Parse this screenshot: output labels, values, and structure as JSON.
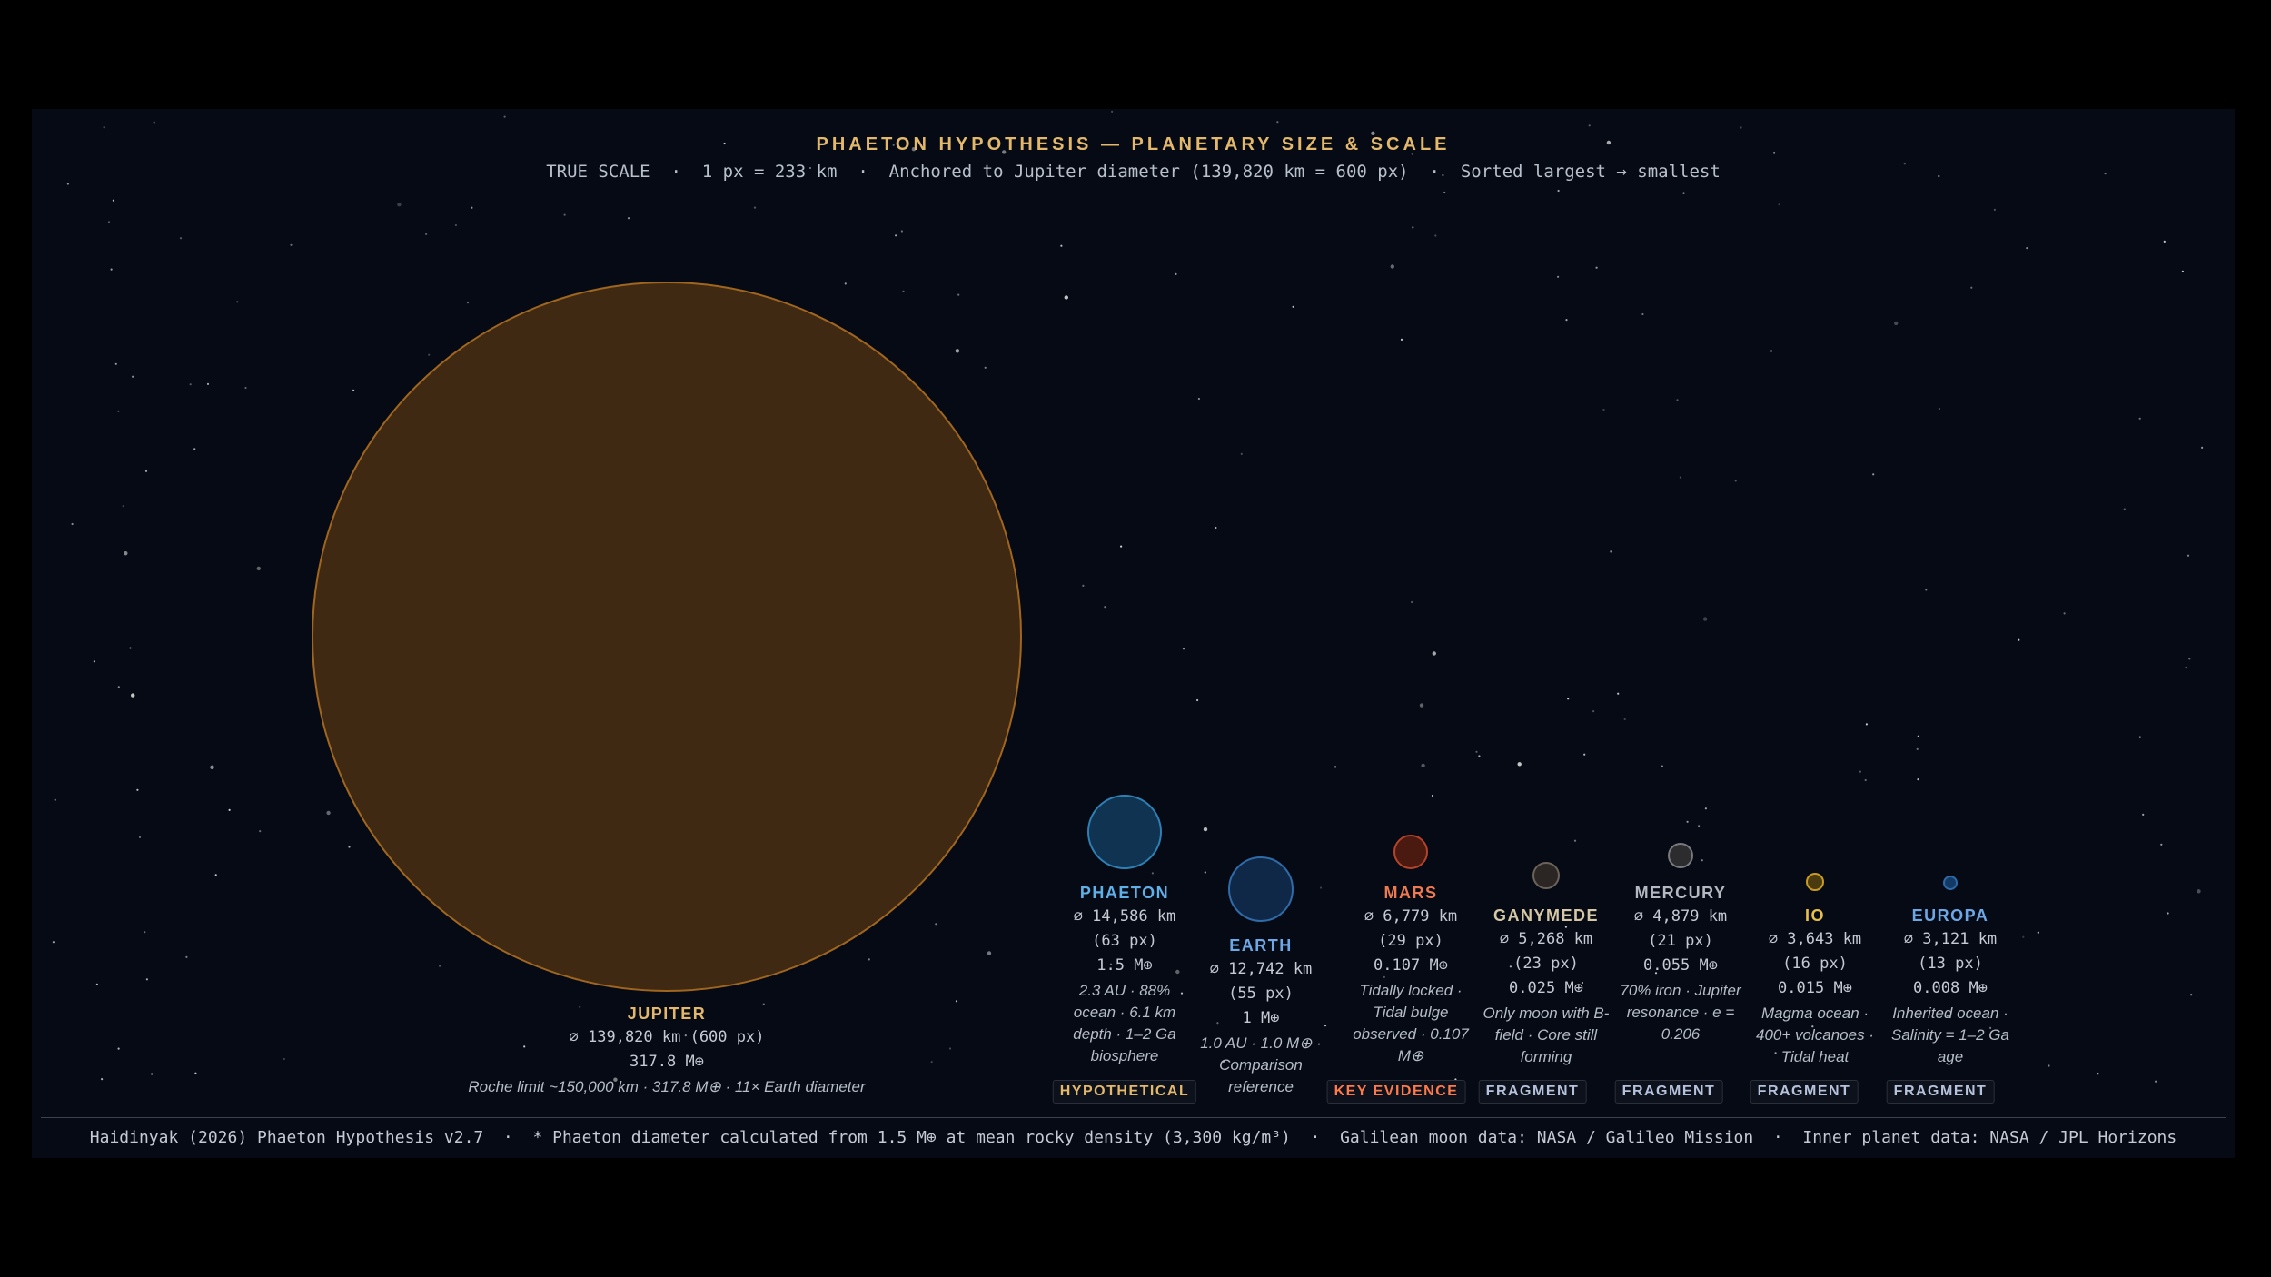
{
  "header": {
    "title": "PHAETON HYPOTHESIS — PLANETARY SIZE & SCALE",
    "subtitle": "TRUE SCALE  ·  1 px = 233 km  ·  Anchored to Jupiter diameter (139,820 km = 600 px)  ·  Sorted largest → smallest"
  },
  "bodies": [
    {
      "name": "JUPITER",
      "diameter": "⌀ 139,820 km (600 px)",
      "mass": "317.8 M⊕",
      "note": "Roche limit ~150,000 km · 317.8 M⊕ · 11× Earth diameter",
      "fill": "#3f2912",
      "stroke": "#a0661f",
      "name_color": "#e4b86a"
    },
    {
      "name": "PHAETON",
      "diameter": "⌀ 14,586 km",
      "pixels": "(63 px)",
      "mass": "1.5 M⊕",
      "note": "2.3 AU · 88% ocean · 6.1 km depth · 1–2 Ga biosphere",
      "tag": "HYPOTHETICAL",
      "tag_color": "#e4b86a",
      "fill": "#0f3350",
      "stroke": "#2e7fb4",
      "name_color": "#5fb0e8"
    },
    {
      "name": "EARTH",
      "diameter": "⌀ 12,742 km",
      "pixels": "(55 px)",
      "mass": "1 M⊕",
      "note": "1.0 AU · 1.0 M⊕ · Comparison reference",
      "fill": "#0f2848",
      "stroke": "#2f6ba8",
      "name_color": "#6ea7e6"
    },
    {
      "name": "MARS",
      "diameter": "⌀ 6,779 km",
      "pixels": "(29 px)",
      "mass": "0.107 M⊕",
      "note": "Tidally locked · Tidal bulge observed · 0.107 M⊕",
      "tag": "KEY EVIDENCE",
      "tag_color": "#ff7a4a",
      "fill": "#4a1a10",
      "stroke": "#b4432a",
      "name_color": "#f07a50"
    },
    {
      "name": "GANYMEDE",
      "diameter": "⌀ 5,268 km",
      "pixels": "(23 px)",
      "mass": "0.025 M⊕",
      "note": "Only moon with B-field · Core still forming",
      "tag": "FRAGMENT",
      "tag_color": "#b6c2dc",
      "fill": "#2b2624",
      "stroke": "#6b625a",
      "name_color": "#d6c8a6"
    },
    {
      "name": "MERCURY",
      "diameter": "⌀ 4,879 km",
      "pixels": "(21 px)",
      "mass": "0.055 M⊕",
      "note": "70% iron · Jupiter resonance · e = 0.206",
      "tag": "FRAGMENT",
      "tag_color": "#b6c2dc",
      "fill": "#2c2c2e",
      "stroke": "#7a7a7e",
      "name_color": "#b4b8c0"
    },
    {
      "name": "IO",
      "diameter": "⌀ 3,643 km",
      "pixels": "(16 px)",
      "mass": "0.015 M⊕",
      "note": "Magma ocean · 400+ volcanoes · Tidal heat",
      "tag": "FRAGMENT",
      "tag_color": "#b6c2dc",
      "fill": "#4a3a10",
      "stroke": "#c99a22",
      "name_color": "#e8c04a"
    },
    {
      "name": "EUROPA",
      "diameter": "⌀ 3,121 km",
      "pixels": "(13 px)",
      "mass": "0.008 M⊕",
      "note": "Inherited ocean · Salinity = 1–2 Ga age",
      "tag": "FRAGMENT",
      "tag_color": "#b6c2dc",
      "fill": "#133a66",
      "stroke": "#2e6aa8",
      "name_color": "#6ea7e6"
    }
  ],
  "footer": {
    "text": "Haidinyak (2026) Phaeton Hypothesis v2.7  ·  * Phaeton diameter calculated from 1.5 M⊕ at mean rocky density (3,300 kg/m³)  ·  Galilean moon data: NASA / Galileo Mission  ·  Inner planet data: NASA / JPL Horizons"
  },
  "colors": {
    "background": "#050a14",
    "title": "#e4b86a"
  }
}
